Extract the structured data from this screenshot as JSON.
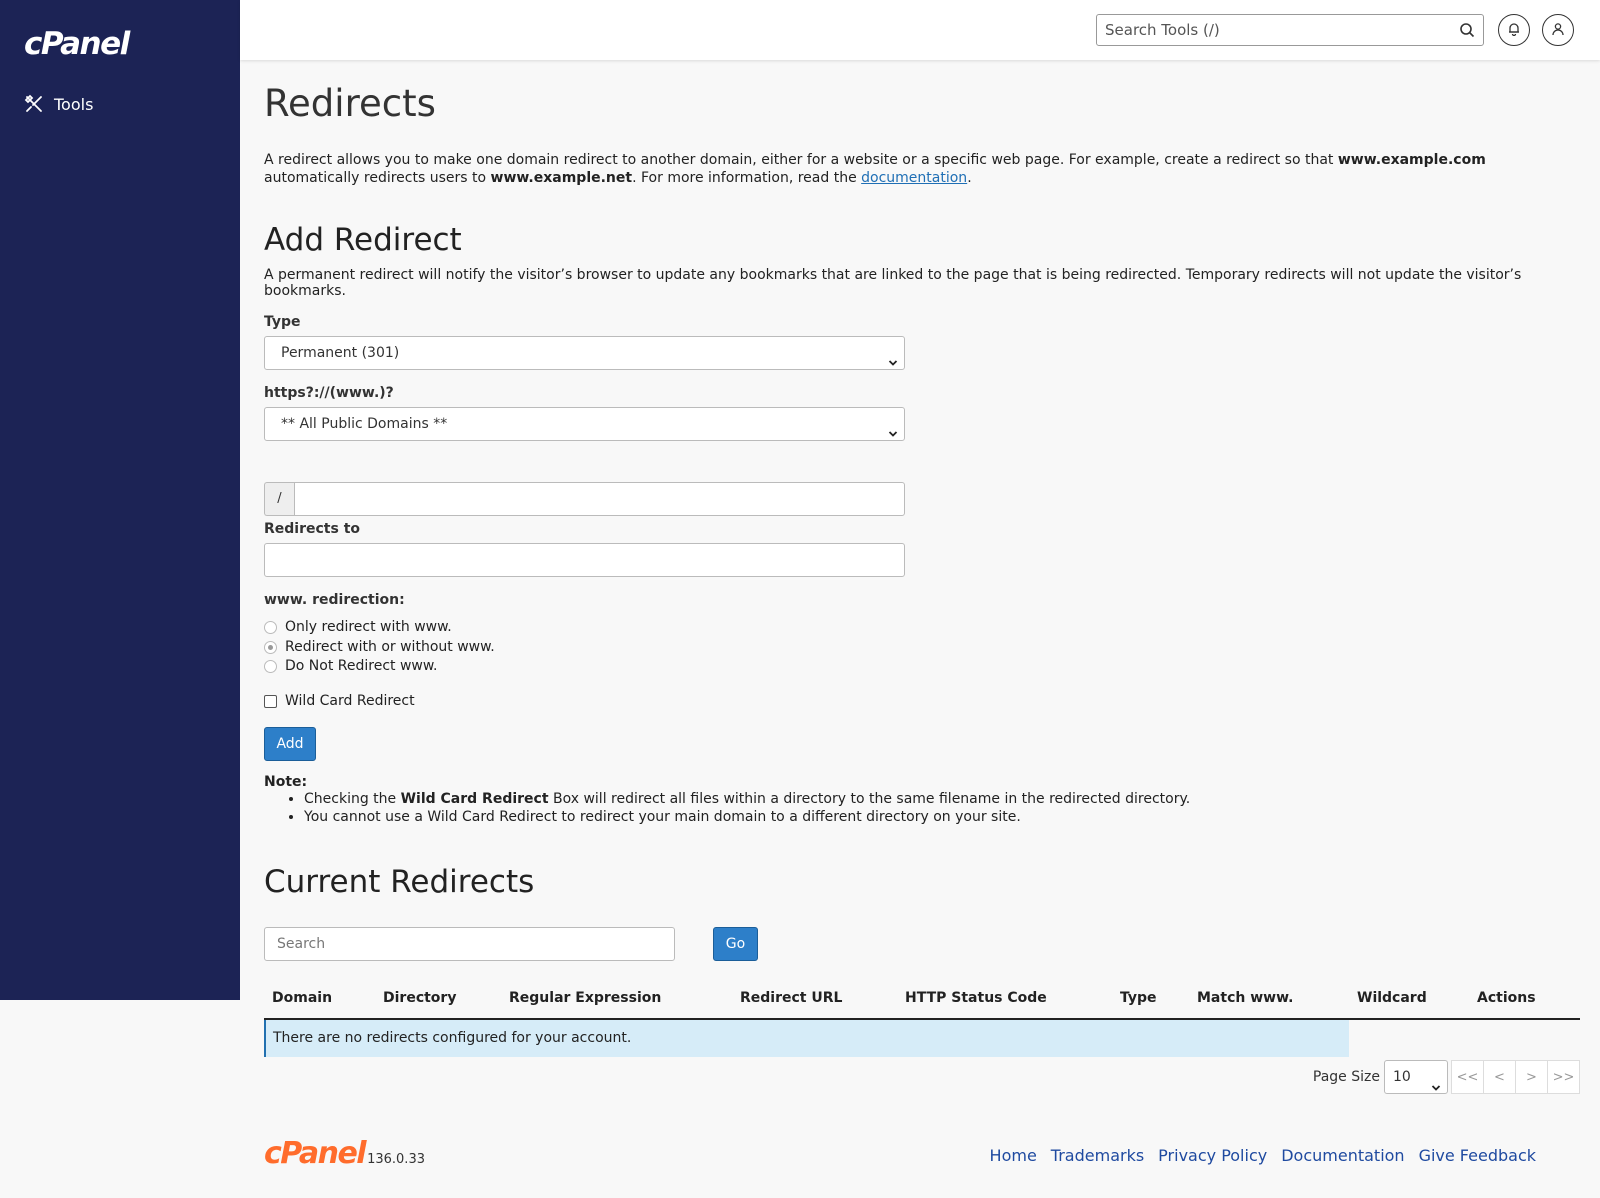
{
  "sidebar": {
    "logo": "cPanel",
    "nav": [
      {
        "label": "Tools",
        "icon": "tools-icon"
      }
    ]
  },
  "topbar": {
    "search_placeholder": "Search Tools (/)",
    "notifications_icon": "bell-icon",
    "user_icon": "user-icon"
  },
  "page": {
    "title": "Redirects",
    "intro_part1": "A redirect allows you to make one domain redirect to another domain, either for a website or a specific web page. For example, create a redirect so that ",
    "intro_bold1": "www.example.com",
    "intro_part2": " automatically redirects users to ",
    "intro_bold2": "www.example.net",
    "intro_part3": ". For more information, read the ",
    "intro_link": "documentation",
    "intro_part4": "."
  },
  "add_redirect": {
    "heading": "Add Redirect",
    "description": "A permanent redirect will notify the visitor’s browser to update any bookmarks that are linked to the page that is being redirected. Temporary redirects will not update the visitor’s bookmarks.",
    "type_label": "Type",
    "type_value": "Permanent (301)",
    "domain_label": "https?://(www.)?",
    "domain_value": "** All Public Domains **",
    "path_prefix": "/",
    "path_value": "",
    "redirects_to_label": "Redirects to",
    "redirects_to_value": "",
    "www_label": "www. redirection:",
    "www_options": [
      {
        "label": "Only redirect with www.",
        "checked": false
      },
      {
        "label": "Redirect with or without www.",
        "checked": true
      },
      {
        "label": "Do Not Redirect www.",
        "checked": false
      }
    ],
    "wildcard_label": "Wild Card Redirect",
    "wildcard_checked": false,
    "add_button": "Add",
    "note_title": "Note:",
    "note_1_pre": "Checking the ",
    "note_1_bold": "Wild Card Redirect",
    "note_1_post": " Box will redirect all files within a directory to the same filename in the redirected directory.",
    "note_2": "You cannot use a Wild Card Redirect to redirect your main domain to a different directory on your site."
  },
  "current_redirects": {
    "heading": "Current Redirects",
    "search_placeholder": "Search",
    "go_button": "Go",
    "columns": [
      "Domain",
      "Directory",
      "Regular Expression",
      "Redirect URL",
      "HTTP Status Code",
      "Type",
      "Match www.",
      "Wildcard",
      "Actions"
    ],
    "empty_message": "There are no redirects configured for your account.",
    "page_size_label": "Page Size",
    "page_size_value": "10",
    "pager": [
      "<<",
      "<",
      ">",
      ">>"
    ]
  },
  "footer": {
    "logo": "cPanel",
    "version": "136.0.33",
    "links": [
      "Home",
      "Trademarks",
      "Privacy Policy",
      "Documentation",
      "Give Feedback"
    ]
  },
  "colors": {
    "sidebar_bg": "#1c2355",
    "primary_button": "#2d7fc9",
    "link": "#1f4aa0",
    "brand_orange": "#ff6c2c",
    "empty_row_bg": "#d6ecf8"
  }
}
